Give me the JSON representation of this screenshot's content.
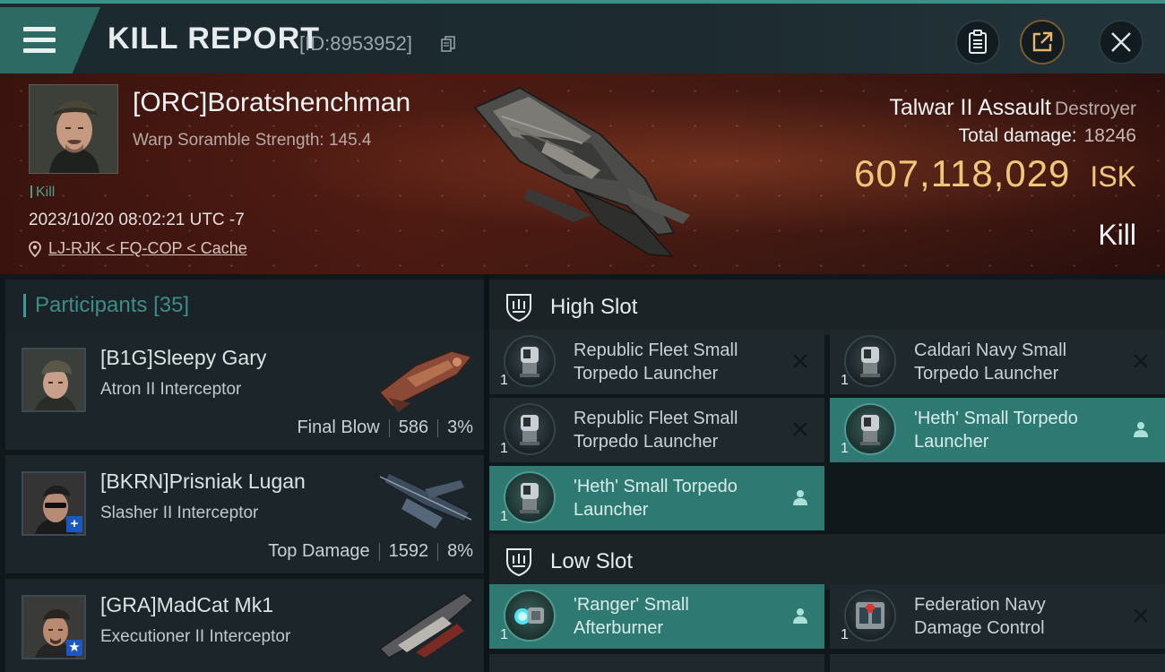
{
  "header": {
    "title": "KILL REPORT",
    "report_id": "[ID:8953952]"
  },
  "victim": {
    "pilot": "[ORC]Boratshenchman",
    "scramble": "Warp Soramble Strength: 145.4",
    "kill_tag": "Kill",
    "datetime": "2023/10/20 08:02:21 UTC -7",
    "location": "LJ-RJK < FQ-COP < Cache",
    "ship": "Talwar II Assault",
    "ship_class": "Destroyer",
    "total_damage_label": "Total damage:",
    "total_damage": "18246",
    "isk_value": "607,118,029",
    "isk_unit": "ISK",
    "result": "Kill"
  },
  "participants": {
    "label": "Participants",
    "count": "[35]",
    "rows": [
      {
        "name": "[B1G]Sleepy Gary",
        "ship": "Atron II Interceptor",
        "tag": "Final Blow",
        "damage": "586",
        "percent": "3%",
        "badge": ""
      },
      {
        "name": "[BKRN]Prisniak Lugan",
        "ship": "Slasher II Interceptor",
        "tag": "Top Damage",
        "damage": "1592",
        "percent": "8%",
        "badge": "+"
      },
      {
        "name": "[GRA]MadCat Mk1",
        "ship": "Executioner II Interceptor",
        "tag": "",
        "damage": "",
        "percent": "",
        "badge": "★"
      }
    ]
  },
  "fitting": {
    "high_slot_label": "High Slot",
    "low_slot_label": "Low Slot",
    "high": [
      {
        "name": "Republic Fleet Small Torpedo Launcher",
        "qty": "1",
        "status": "destroyed"
      },
      {
        "name": "Caldari Navy Small Torpedo Launcher",
        "qty": "1",
        "status": "destroyed"
      },
      {
        "name": "Republic Fleet Small Torpedo Launcher",
        "qty": "1",
        "status": "destroyed"
      },
      {
        "name": "'Heth' Small Torpedo Launcher",
        "qty": "1",
        "status": "dropped"
      },
      {
        "name": "'Heth' Small Torpedo Launcher",
        "qty": "1",
        "status": "dropped"
      }
    ],
    "low": [
      {
        "name": "'Ranger' Small Afterburner",
        "qty": "1",
        "status": "dropped"
      },
      {
        "name": "Federation Navy Damage Control",
        "qty": "1",
        "status": "destroyed"
      }
    ]
  },
  "colors": {
    "accent": "#3f8f86",
    "isk": "#f0c77a",
    "dropped_bg": "#2e7a72",
    "hero_red": "#4a1a12"
  }
}
